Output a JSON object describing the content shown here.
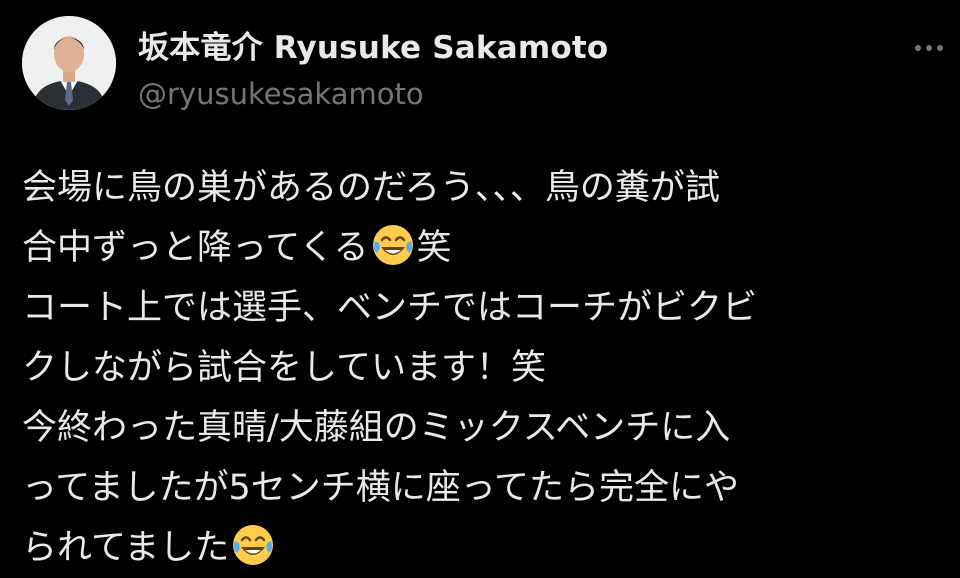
{
  "author": {
    "display_name": "坂本竜介 Ryusuke Sakamoto",
    "handle": "@ryusukesakamoto",
    "avatar_icon": "profile-photo",
    "more_icon": "more-options-icon"
  },
  "tweet": {
    "lines": [
      {
        "text": "会場に鳥の巣があるのだろう、、、鳥の糞が試",
        "emoji": ""
      },
      {
        "text": "合中ずっと降ってくる",
        "emoji": "face-with-tears-of-joy",
        "after": "笑"
      },
      {
        "text": "コート上では選手、ベンチではコーチがビクビ",
        "emoji": ""
      },
      {
        "text": "クしながら試合をしています！笑",
        "emoji": ""
      },
      {
        "text": "今終わった真晴/大藤組のミックスベンチに入",
        "emoji": ""
      },
      {
        "text": "ってましたが5センチ横に座ってたら完全にや",
        "emoji": ""
      },
      {
        "text": "られてました",
        "emoji": "face-with-tears-of-joy",
        "after": ""
      }
    ]
  },
  "colors": {
    "background": "#000000",
    "text_primary": "#e7e9ea",
    "text_secondary": "#71767b",
    "emoji_yellow": "#ffcc4d"
  }
}
